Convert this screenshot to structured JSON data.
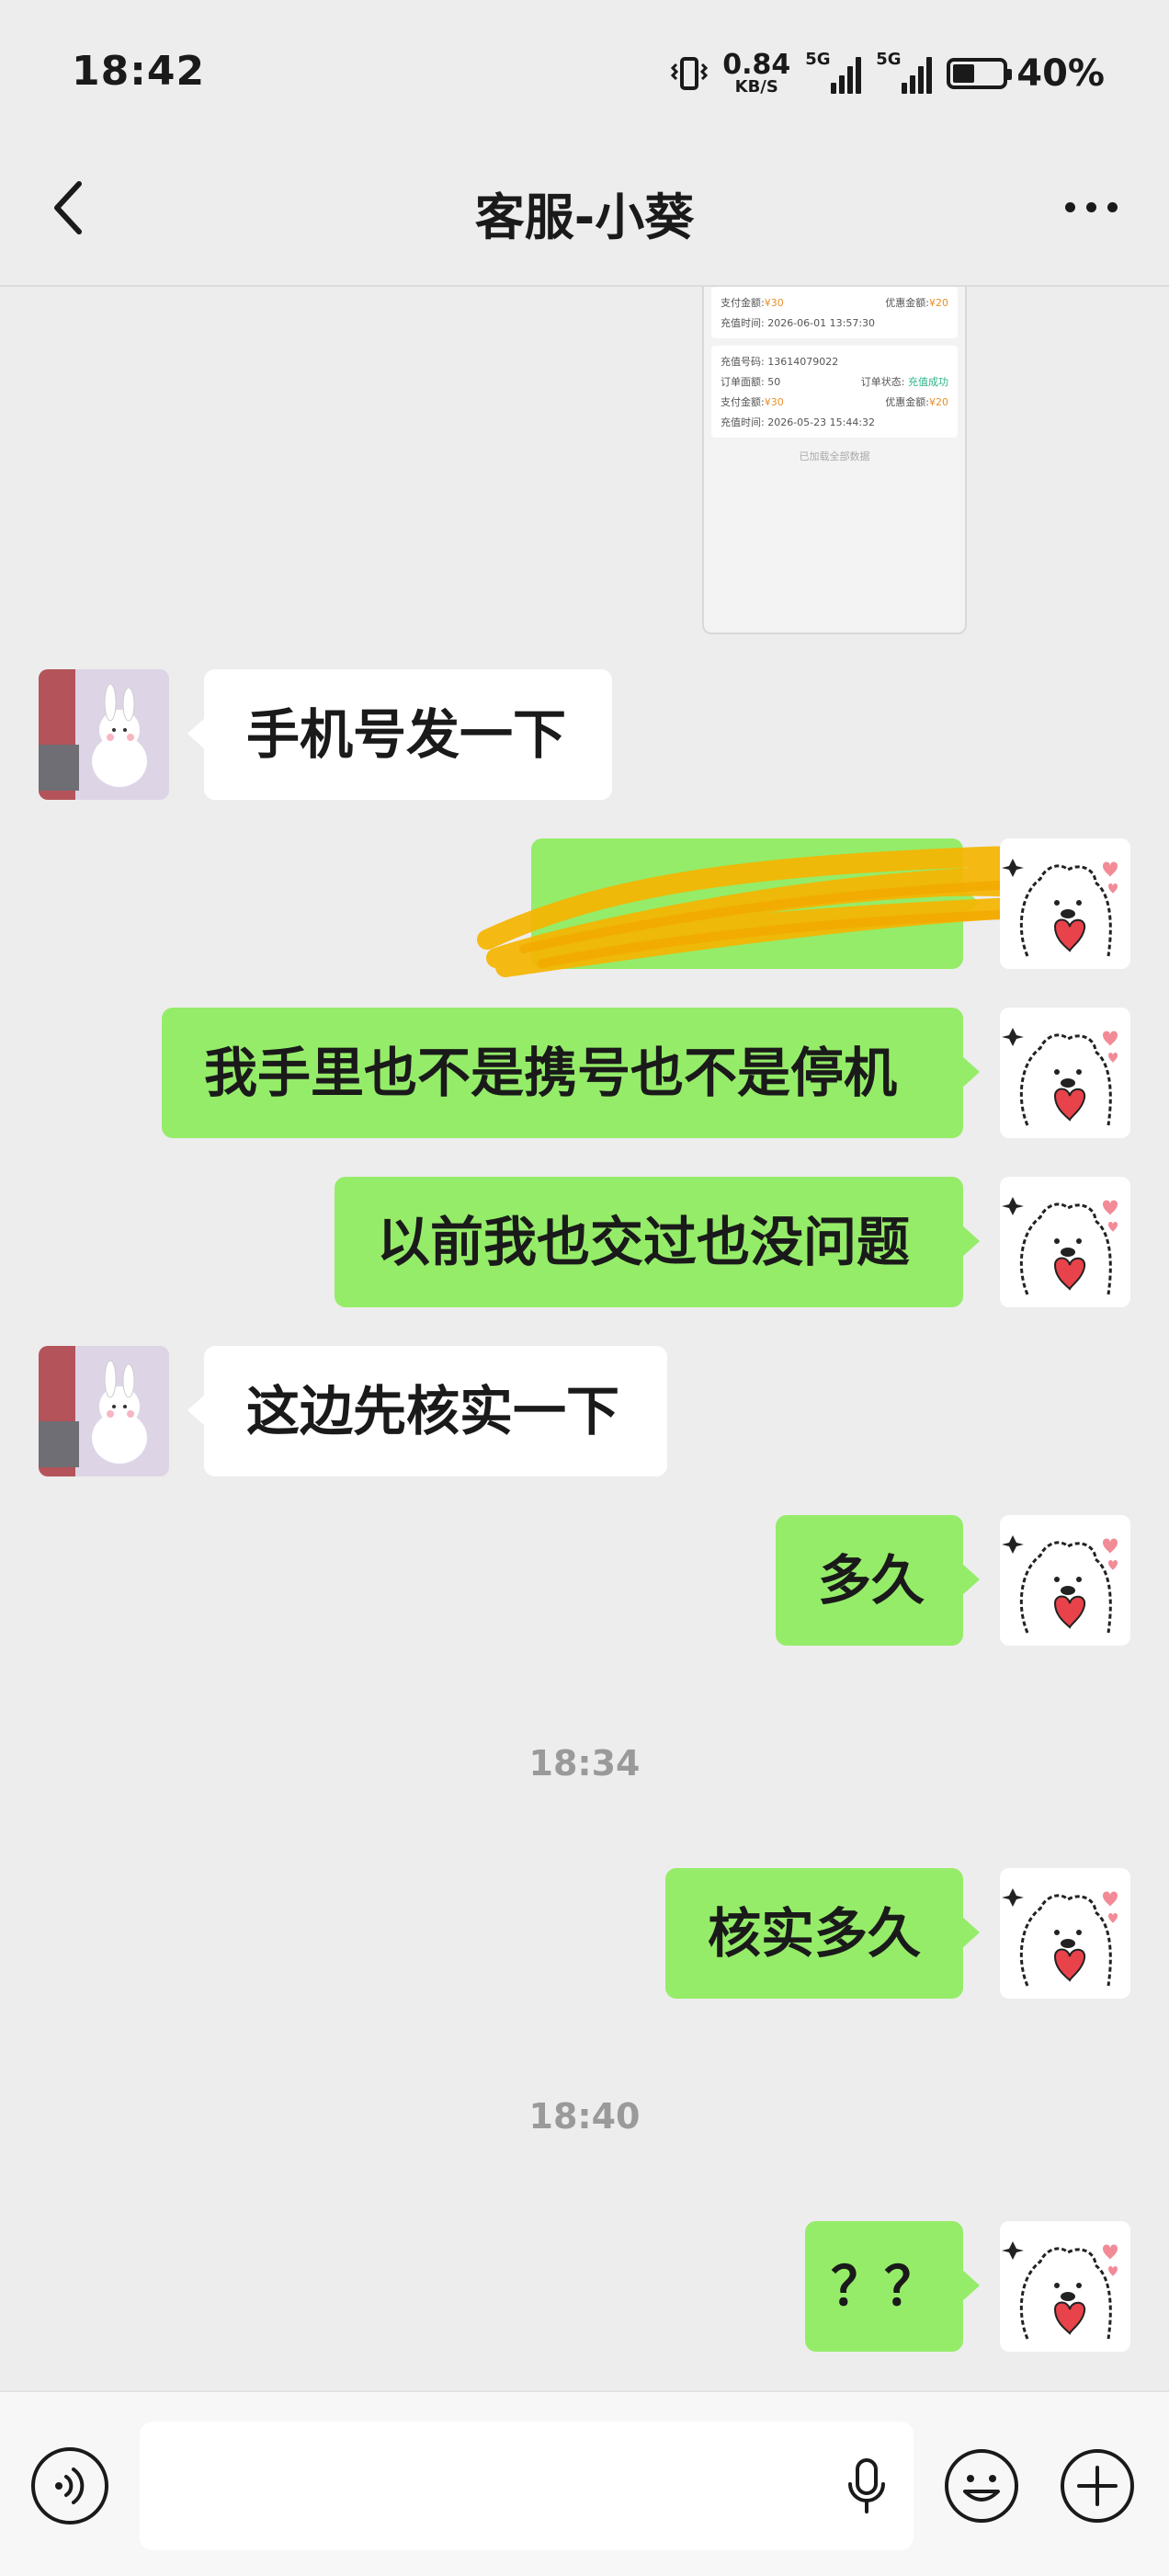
{
  "status_bar": {
    "time": "18:42",
    "net_speed_value": "0.84",
    "net_speed_unit": "KB/S",
    "sim1_label": "5G",
    "sim2_label": "5G",
    "battery_percent": "40%",
    "battery_level": 0.4
  },
  "header": {
    "title": "客服-小葵"
  },
  "screenshot_card": {
    "top_block": {
      "pay_label": "支付金额:",
      "pay_value": "¥30",
      "discount_label": "优惠金额:",
      "discount_value": "¥20",
      "time_label": "充值时间:",
      "time_value": "2026-06-01 13:57:30"
    },
    "order": {
      "phone_label": "充值号码:",
      "phone_value": "13614079022",
      "amount_label": "订单面额:",
      "amount_value": "50",
      "status_label": "订单状态:",
      "status_value": "充值成功",
      "pay_label": "支付金额:",
      "pay_value": "¥30",
      "discount_label": "优惠金额:",
      "discount_value": "¥20",
      "time_label": "充值时间:",
      "time_value": "2026-05-23 15:44:32"
    },
    "footer": "已加载全部数据"
  },
  "messages": [
    {
      "side": "in",
      "text": "手机号发一下"
    },
    {
      "side": "out",
      "text": ""
    },
    {
      "side": "out",
      "text": "我手里也不是携号也不是停机"
    },
    {
      "side": "out",
      "text": "以前我也交过也没问题"
    },
    {
      "side": "in",
      "text": "这边先核实一下"
    },
    {
      "side": "out",
      "text": "多久"
    },
    {
      "side": "out",
      "text": "核实多久"
    },
    {
      "side": "out",
      "text": "？？"
    }
  ],
  "time_labels": [
    "18:34",
    "18:40"
  ],
  "icons": {
    "back": "chevron-left-icon",
    "more": "more-dots-icon",
    "voice": "voice-icon",
    "mic": "microphone-icon",
    "emoji": "emoji-icon",
    "plus": "plus-icon"
  },
  "colors": {
    "background": "#ededed",
    "outgoing_bubble": "#95ec69",
    "incoming_bubble": "#ffffff",
    "scribble": "#f5b400"
  }
}
